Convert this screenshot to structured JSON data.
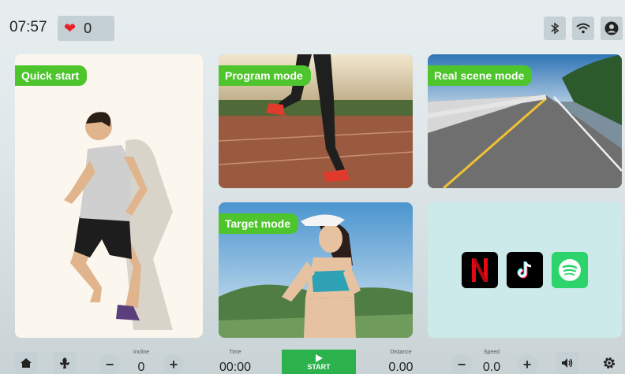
{
  "status": {
    "time": "07:57",
    "heart_rate": "0"
  },
  "tiles": {
    "quick_start": "Quick start",
    "program_mode": "Program mode",
    "real_scene_mode": "Real scene mode",
    "target_mode": "Target mode"
  },
  "apps": [
    "netflix",
    "tiktok",
    "spotify"
  ],
  "metrics": {
    "incline": {
      "label": "Incline",
      "value": "0"
    },
    "time": {
      "label": "Time",
      "value": "00:00"
    },
    "distance": {
      "label": "Distance",
      "value": "0.00"
    },
    "speed": {
      "label": "Speed",
      "value": "0.0"
    }
  },
  "start_label": "START",
  "colors": {
    "accent_green": "#4ec42d",
    "start_green": "#2bb24c",
    "netflix_red": "#e50914",
    "spotify_green": "#1ed760"
  }
}
